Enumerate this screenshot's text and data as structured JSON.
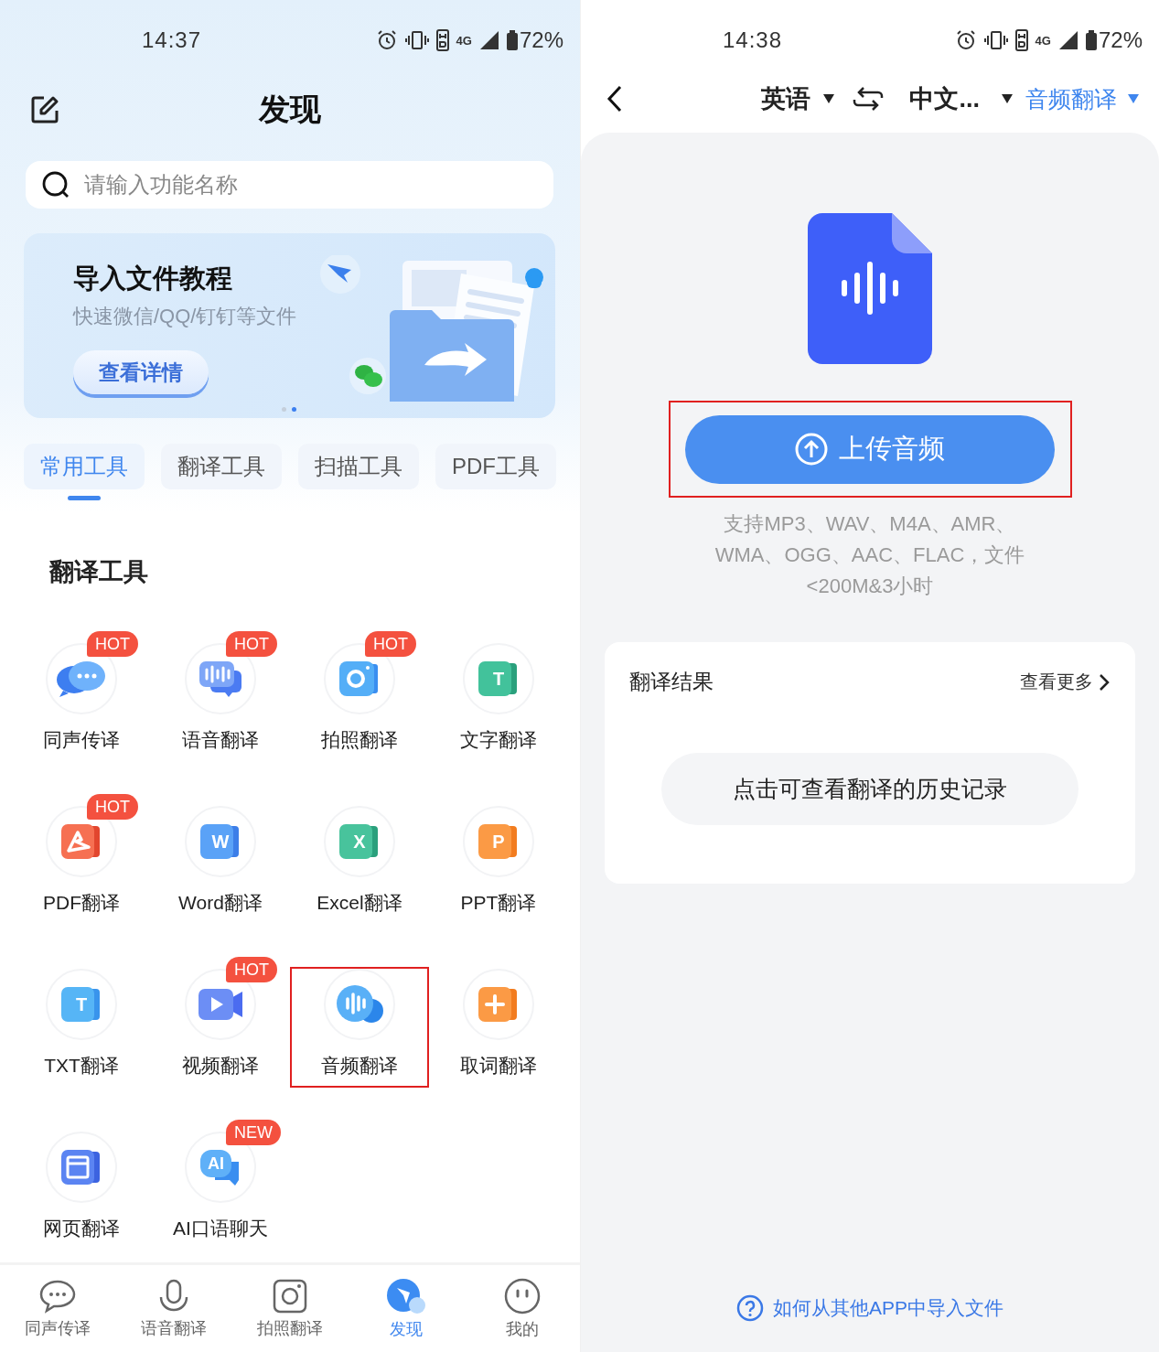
{
  "discover_screen": {
    "status_bar": {
      "time": "14:37",
      "network": "4G",
      "battery": "72%"
    },
    "header": {
      "title": "发现"
    },
    "search": {
      "placeholder": "请输入功能名称"
    },
    "banner": {
      "title": "导入文件教程",
      "subtitle": "快速微信/QQ/钉钉等文件",
      "button": "查看详情",
      "pages": [
        {
          "selected": false
        },
        {
          "selected": true
        }
      ]
    },
    "category_tabs": [
      {
        "label": "常用工具",
        "selected": true
      },
      {
        "label": "翻译工具",
        "selected": false
      },
      {
        "label": "扫描工具",
        "selected": false
      },
      {
        "label": "PDF工具",
        "selected": false
      }
    ],
    "section": {
      "title": "翻译工具"
    },
    "tools": [
      {
        "label": "同声传译",
        "badge": "HOT",
        "highlighted": false
      },
      {
        "label": "语音翻译",
        "badge": "HOT",
        "highlighted": false
      },
      {
        "label": "拍照翻译",
        "badge": "HOT",
        "highlighted": false
      },
      {
        "label": "文字翻译",
        "icon_letter": "T",
        "highlighted": false
      },
      {
        "label": "PDF翻译",
        "badge": "HOT",
        "highlighted": false
      },
      {
        "label": "Word翻译",
        "icon_letter": "W",
        "highlighted": false
      },
      {
        "label": "Excel翻译",
        "icon_letter": "X",
        "highlighted": false
      },
      {
        "label": "PPT翻译",
        "icon_letter": "P",
        "highlighted": false
      },
      {
        "label": "TXT翻译",
        "icon_letter": "T",
        "highlighted": false
      },
      {
        "label": "视频翻译",
        "badge": "HOT",
        "highlighted": false
      },
      {
        "label": "音频翻译",
        "highlighted": true
      },
      {
        "label": "取词翻译",
        "highlighted": false
      },
      {
        "label": "网页翻译",
        "highlighted": false
      },
      {
        "label": "AI口语聊天",
        "badge": "NEW",
        "icon_letter": "AI",
        "highlighted": false
      }
    ],
    "bottom_nav": [
      {
        "label": "同声传译",
        "selected": false
      },
      {
        "label": "语音翻译",
        "selected": false
      },
      {
        "label": "拍照翻译",
        "selected": false
      },
      {
        "label": "发现",
        "selected": true
      },
      {
        "label": "我的",
        "selected": false
      }
    ]
  },
  "audio_screen": {
    "status_bar": {
      "time": "14:38",
      "network": "4G",
      "battery": "72%"
    },
    "toolbar": {
      "source_language": "英语",
      "target_language": "中文...",
      "mode": "音频翻译"
    },
    "upload_button": {
      "label": "上传音频",
      "highlighted": true
    },
    "formats_note": [
      "支持MP3、WAV、M4A、AMR、",
      "WMA、OGG、AAC、FLAC，文件",
      "<200M&3小时"
    ],
    "results": {
      "title": "翻译结果",
      "more_link": "查看更多",
      "history_button": "点击可查看翻译的历史记录"
    },
    "help_link": "如何从其他APP中导入文件"
  }
}
